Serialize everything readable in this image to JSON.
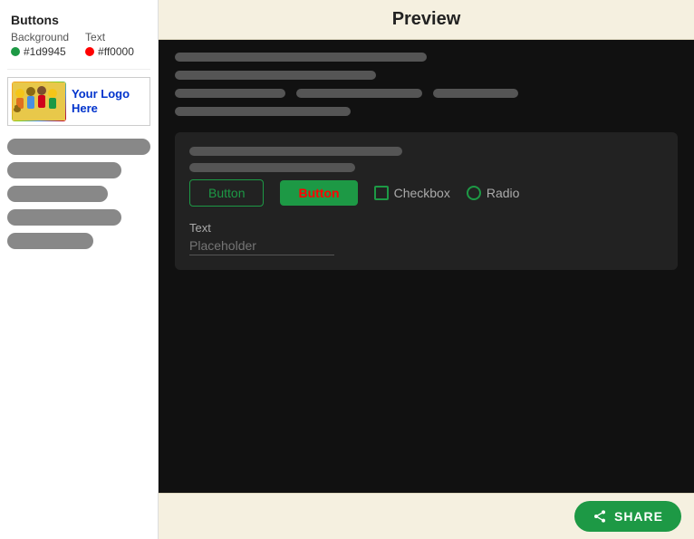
{
  "sidebar": {
    "section_title": "Buttons",
    "background_label": "Background",
    "text_label": "Text",
    "bg_color": "#1d9945",
    "text_color": "#ff0000",
    "bg_color_display": "#1d9945",
    "text_color_display": "#ff0000",
    "logo_text_line1": "Your Logo",
    "logo_text_line2": "Here",
    "nav_bars": [
      "bar1",
      "bar2",
      "bar3",
      "bar4",
      "bar5"
    ]
  },
  "main": {
    "header_title": "Preview",
    "content_bars": [
      "bar1",
      "bar2"
    ],
    "inline_bars": [
      "bar1",
      "bar2",
      "bar3"
    ],
    "bottom_bar": "bar1",
    "widget": {
      "bar1": "top-bar",
      "bar2": "second-bar",
      "btn_outline_label": "Button",
      "btn_filled_label": "Button",
      "checkbox_label": "Checkbox",
      "radio_label": "Radio",
      "text_label": "Text",
      "placeholder": "Placeholder"
    }
  },
  "share_button": {
    "label": "SHARE"
  }
}
